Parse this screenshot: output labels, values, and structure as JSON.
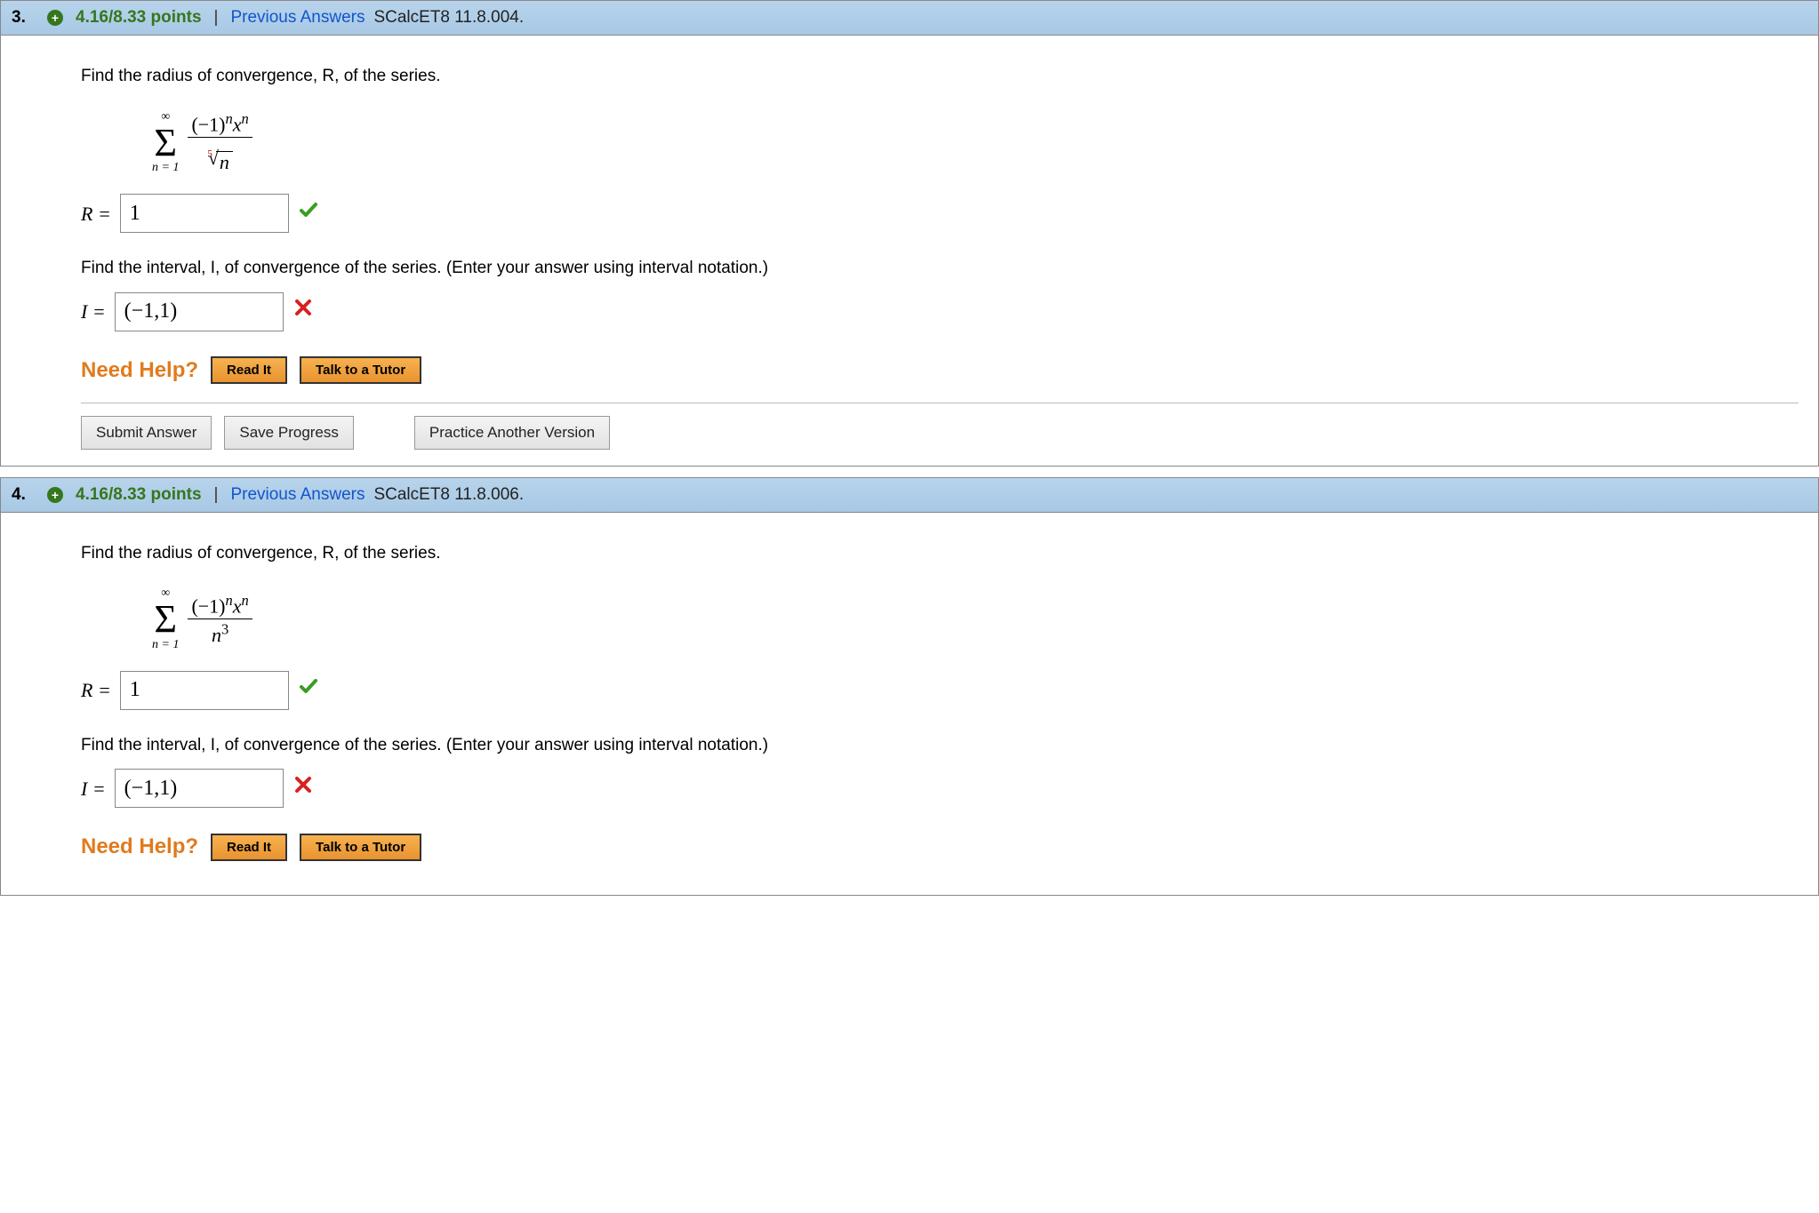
{
  "questions": [
    {
      "number": "3.",
      "points": "4.16/8.33 points",
      "prev_answers": "Previous Answers",
      "source_ref": "SCalcET8 11.8.004.",
      "prompt_radius": "Find the radius of convergence, R, of the series.",
      "series": {
        "upper": "∞",
        "lower": "n = 1",
        "numerator": "(−1)ⁿxⁿ",
        "denominator_type": "root",
        "root_index": "5",
        "radicand": "n"
      },
      "R_label": "R =",
      "R_value": "1",
      "R_correct": true,
      "prompt_interval": "Find the interval, I, of convergence of the series. (Enter your answer using interval notation.)",
      "I_label": "I =",
      "I_value": "(−1,1)",
      "I_correct": false,
      "need_help": "Need Help?",
      "help_read": "Read It",
      "help_tutor": "Talk to a Tutor",
      "submit": "Submit Answer",
      "save": "Save Progress",
      "practice": "Practice Another Version",
      "show_actions": true
    },
    {
      "number": "4.",
      "points": "4.16/8.33 points",
      "prev_answers": "Previous Answers",
      "source_ref": "SCalcET8 11.8.006.",
      "prompt_radius": "Find the radius of convergence, R, of the series.",
      "series": {
        "upper": "∞",
        "lower": "n = 1",
        "numerator": "(−1)ⁿxⁿ",
        "denominator_type": "power",
        "base": "n",
        "exp": "3"
      },
      "R_label": "R =",
      "R_value": "1",
      "R_correct": true,
      "prompt_interval": "Find the interval, I, of convergence of the series. (Enter your answer using interval notation.)",
      "I_label": "I =",
      "I_value": "(−1,1)",
      "I_correct": false,
      "need_help": "Need Help?",
      "help_read": "Read It",
      "help_tutor": "Talk to a Tutor",
      "show_actions": false
    }
  ]
}
